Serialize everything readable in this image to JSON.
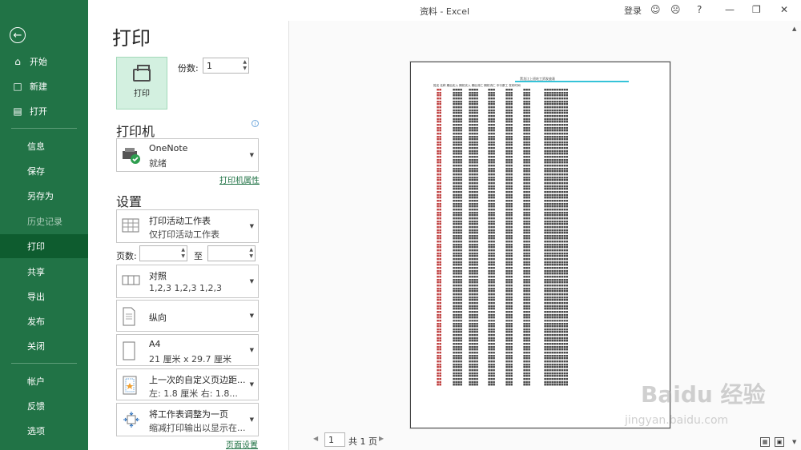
{
  "app": {
    "title": "资料  -  Excel",
    "login": "登录",
    "help": "?"
  },
  "sidebar": {
    "back_icon": "back-arrow-icon",
    "items": [
      {
        "label": "开始",
        "icon": "home-icon"
      },
      {
        "label": "新建",
        "icon": "new-document-icon"
      },
      {
        "label": "打开",
        "icon": "open-folder-icon"
      },
      {
        "label": "信息"
      },
      {
        "label": "保存"
      },
      {
        "label": "另存为"
      },
      {
        "label": "历史记录"
      },
      {
        "label": "打印"
      },
      {
        "label": "共享"
      },
      {
        "label": "导出"
      },
      {
        "label": "发布"
      },
      {
        "label": "关闭"
      },
      {
        "label": "帐户"
      },
      {
        "label": "反馈"
      },
      {
        "label": "选项"
      }
    ]
  },
  "print": {
    "heading": "打印",
    "button_label": "打印",
    "copies_label": "份数:",
    "copies_value": "1",
    "printer_heading": "打印机",
    "printer_name": "OneNote",
    "printer_status": "就绪",
    "printer_props": "打印机属性",
    "settings_heading": "设置",
    "scope_main": "打印活动工作表",
    "scope_sub": "仅打印活动工作表",
    "pages_label": "页数:",
    "to_label": "至",
    "collate_main": "对照",
    "collate_sub": "1,2,3    1,2,3    1,2,3",
    "orientation": "纵向",
    "paper_main": "A4",
    "paper_sub": "21 厘米 x 29.7 厘米",
    "margins_main": "上一次的自定义页边距...",
    "margins_sub": "左: 1.8 厘米    右: 1.8...",
    "scaling_main": "将工作表调整为一页",
    "scaling_sub": "缩减打印输出以显示在...",
    "page_setup": "页面设置"
  },
  "preview": {
    "sheet_title": "黑龙江上班吃工资发放表",
    "header": "姓名 名称  期后实入  期初实入  期后流仁  期初流仁  中行原工  发布时间",
    "rows_a_time": "2018.11.26 16:28:38",
    "page_current": "1",
    "page_total": "共 1 页"
  },
  "watermark": {
    "brand": "Baidu 经验",
    "url": "jingyan.baidu.com"
  }
}
